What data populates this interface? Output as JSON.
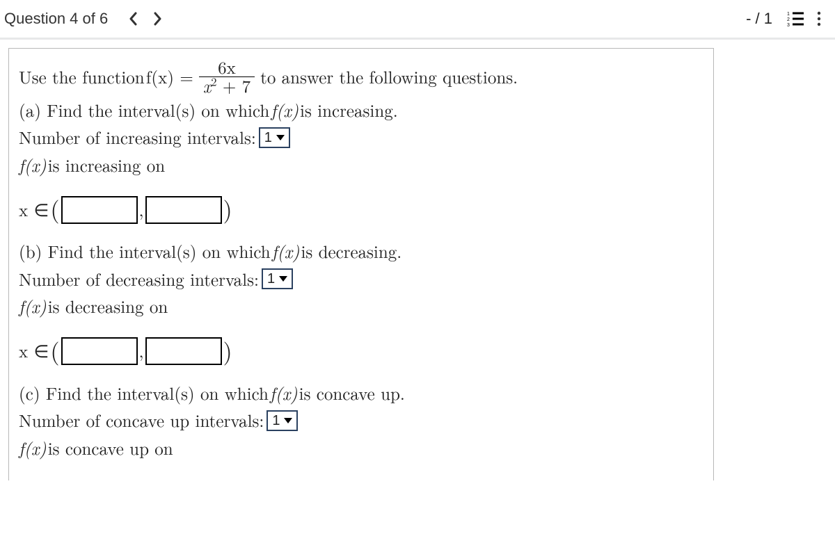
{
  "header": {
    "question_label": "Question 4 of 6",
    "score": "- / 1"
  },
  "problem": {
    "intro_before": "Use the function ",
    "func_lhs": "f(x) = ",
    "frac_num": "6x",
    "frac_den_x": "x",
    "frac_den_exp": "2",
    "frac_den_plus": " + 7",
    "intro_after": " to answer the following questions.",
    "parts": {
      "a": {
        "label": "(a) Find the interval(s) on which ",
        "fx": "f(x)",
        "tail": " is increasing.",
        "count_label": "Number of increasing intervals: ",
        "count_value": "1",
        "statement_fx": "f(x)",
        "statement_tail": " is increasing on",
        "interval_prefix": "x ∈",
        "open": "(",
        "comma": ",",
        "close": ")"
      },
      "b": {
        "label": "(b) Find the interval(s) on which ",
        "fx": "f(x)",
        "tail": " is decreasing.",
        "count_label": "Number of decreasing intervals: ",
        "count_value": "1",
        "statement_fx": "f(x)",
        "statement_tail": " is decreasing on",
        "interval_prefix": "x ∈",
        "open": "(",
        "comma": ",",
        "close": ")"
      },
      "c": {
        "label": "(c) Find the interval(s) on which ",
        "fx": "f(x)",
        "tail": " is concave up.",
        "count_label": "Number of concave up intervals: ",
        "count_value": "1",
        "statement_fx": "f(x)",
        "statement_tail": " is concave up on"
      }
    }
  }
}
